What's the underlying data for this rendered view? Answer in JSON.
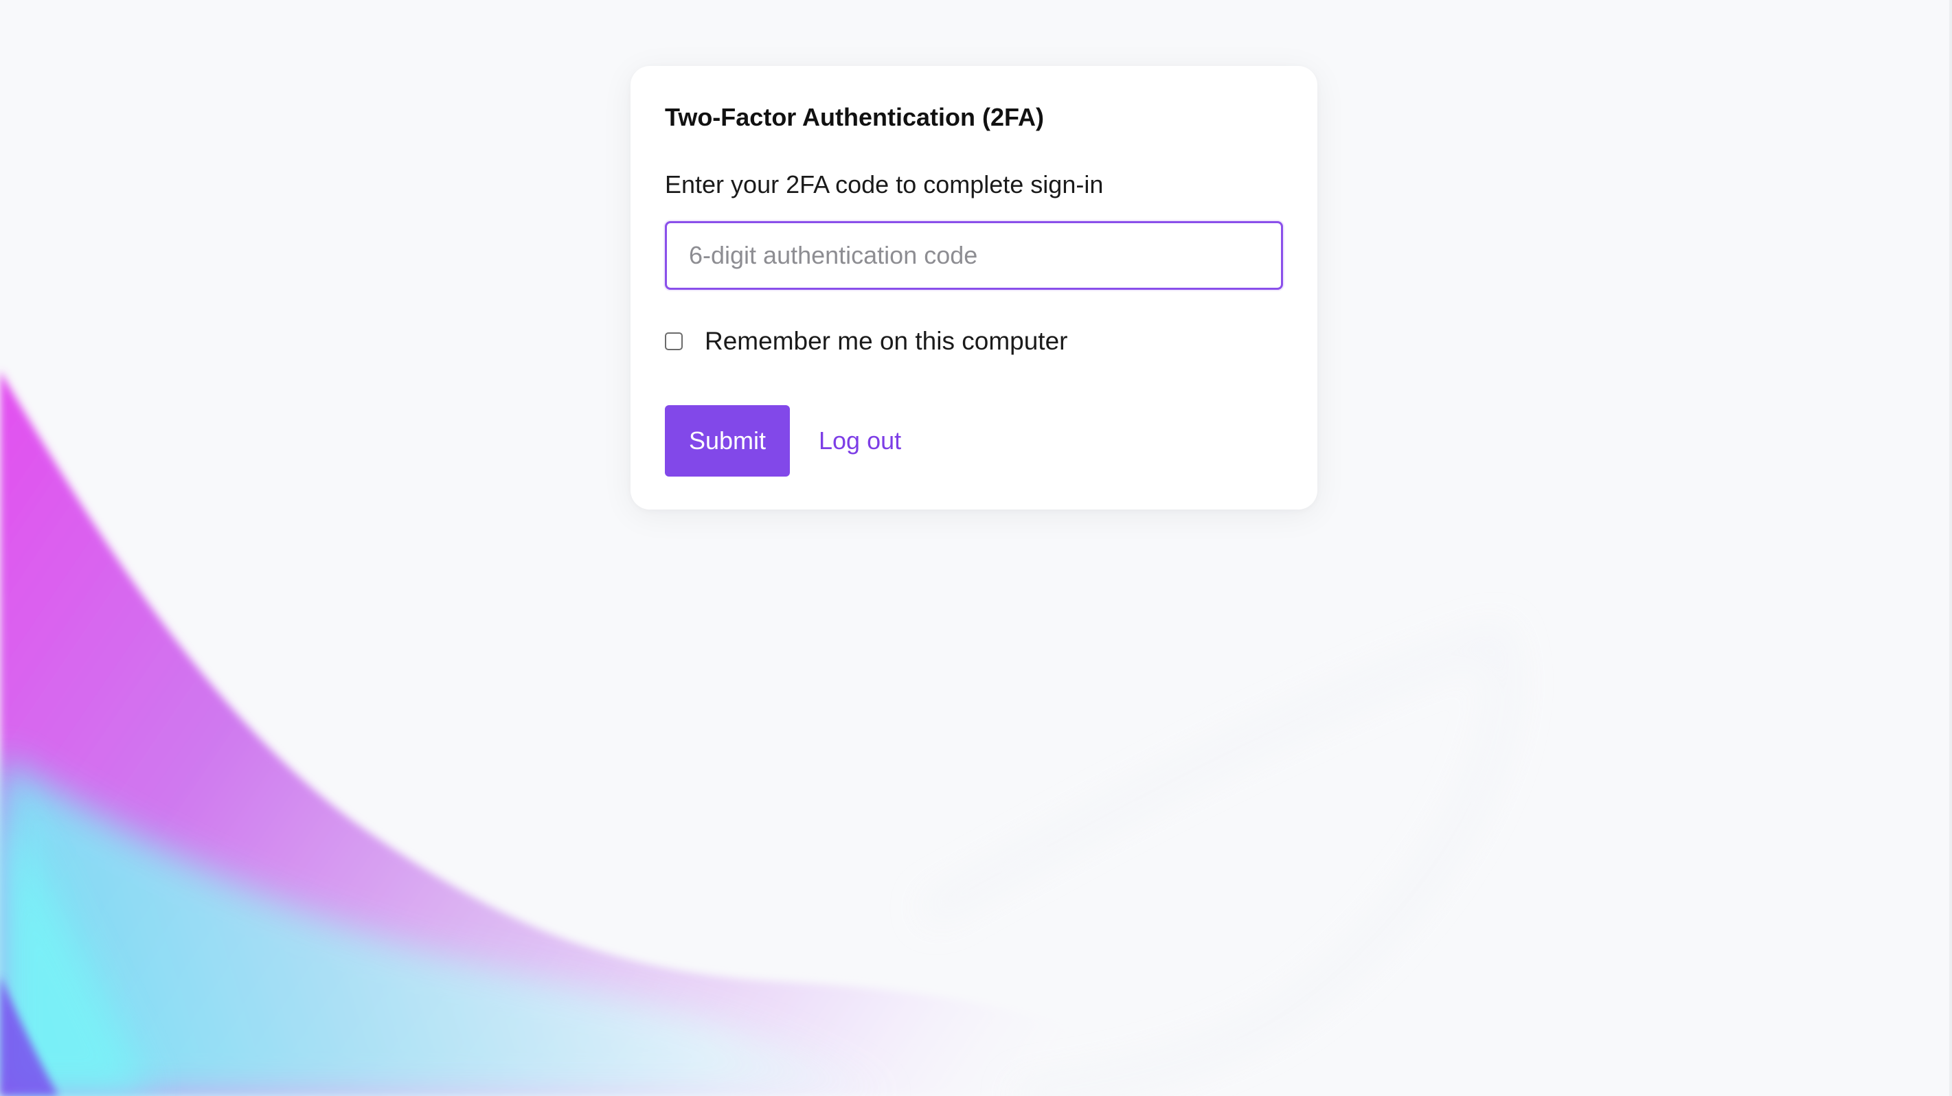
{
  "colors": {
    "accent": "#8248e9",
    "link": "#7d3ee6",
    "page_background": "#f8f9fb",
    "card_background": "#ffffff",
    "wave_magenta": "#e34ff0",
    "wave_cyan": "#6ff4f7",
    "wave_violet": "#7a4ff0"
  },
  "card": {
    "title": "Two-Factor Authentication (2FA)",
    "instruction": "Enter your 2FA code to complete sign-in",
    "code_input": {
      "value": "",
      "placeholder": "6-digit authentication code"
    },
    "remember": {
      "label": "Remember me on this computer",
      "checked": false
    },
    "submit_label": "Submit",
    "logout_label": "Log out"
  }
}
